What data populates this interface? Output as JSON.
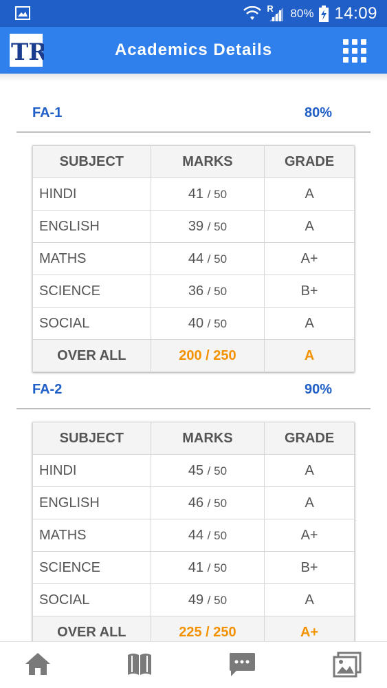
{
  "status_bar": {
    "network_badge": "R",
    "battery": "80%",
    "time": "14:09"
  },
  "app_bar": {
    "logo_text": "TR",
    "title": "Academics Details"
  },
  "colors": {
    "status_bar": "#1f5fc7",
    "app_bar": "#2f80ed",
    "section_title": "#1f5fc7",
    "overall_highlight": "#f39200"
  },
  "sections": [
    {
      "name": "FA-1",
      "percentage": "80%",
      "headers": {
        "subject": "SUBJECT",
        "marks": "MARKS",
        "grade": "GRADE"
      },
      "rows": [
        {
          "subject": "HINDI",
          "marks": "41",
          "out_of": "/ 50",
          "grade": "A"
        },
        {
          "subject": "ENGLISH",
          "marks": "39",
          "out_of": "/ 50",
          "grade": "A"
        },
        {
          "subject": "MATHS",
          "marks": "44",
          "out_of": "/ 50",
          "grade": "A+"
        },
        {
          "subject": "SCIENCE",
          "marks": "36",
          "out_of": "/ 50",
          "grade": "B+"
        },
        {
          "subject": "SOCIAL",
          "marks": "40",
          "out_of": "/ 50",
          "grade": "A"
        }
      ],
      "overall": {
        "label": "OVER ALL",
        "marks": "200 / 250",
        "grade": "A"
      }
    },
    {
      "name": "FA-2",
      "percentage": "90%",
      "headers": {
        "subject": "SUBJECT",
        "marks": "MARKS",
        "grade": "GRADE"
      },
      "rows": [
        {
          "subject": "HINDI",
          "marks": "45",
          "out_of": "/ 50",
          "grade": "A"
        },
        {
          "subject": "ENGLISH",
          "marks": "46",
          "out_of": "/ 50",
          "grade": "A"
        },
        {
          "subject": "MATHS",
          "marks": "44",
          "out_of": "/ 50",
          "grade": "A+"
        },
        {
          "subject": "SCIENCE",
          "marks": "41",
          "out_of": "/ 50",
          "grade": "B+"
        },
        {
          "subject": "SOCIAL",
          "marks": "49",
          "out_of": "/ 50",
          "grade": "A"
        }
      ],
      "overall": {
        "label": "OVER ALL",
        "marks": "225 / 250",
        "grade": "A+"
      }
    }
  ],
  "bottom_nav": [
    {
      "icon": "home-icon"
    },
    {
      "icon": "book-icon"
    },
    {
      "icon": "chat-icon"
    },
    {
      "icon": "gallery-icon"
    }
  ]
}
